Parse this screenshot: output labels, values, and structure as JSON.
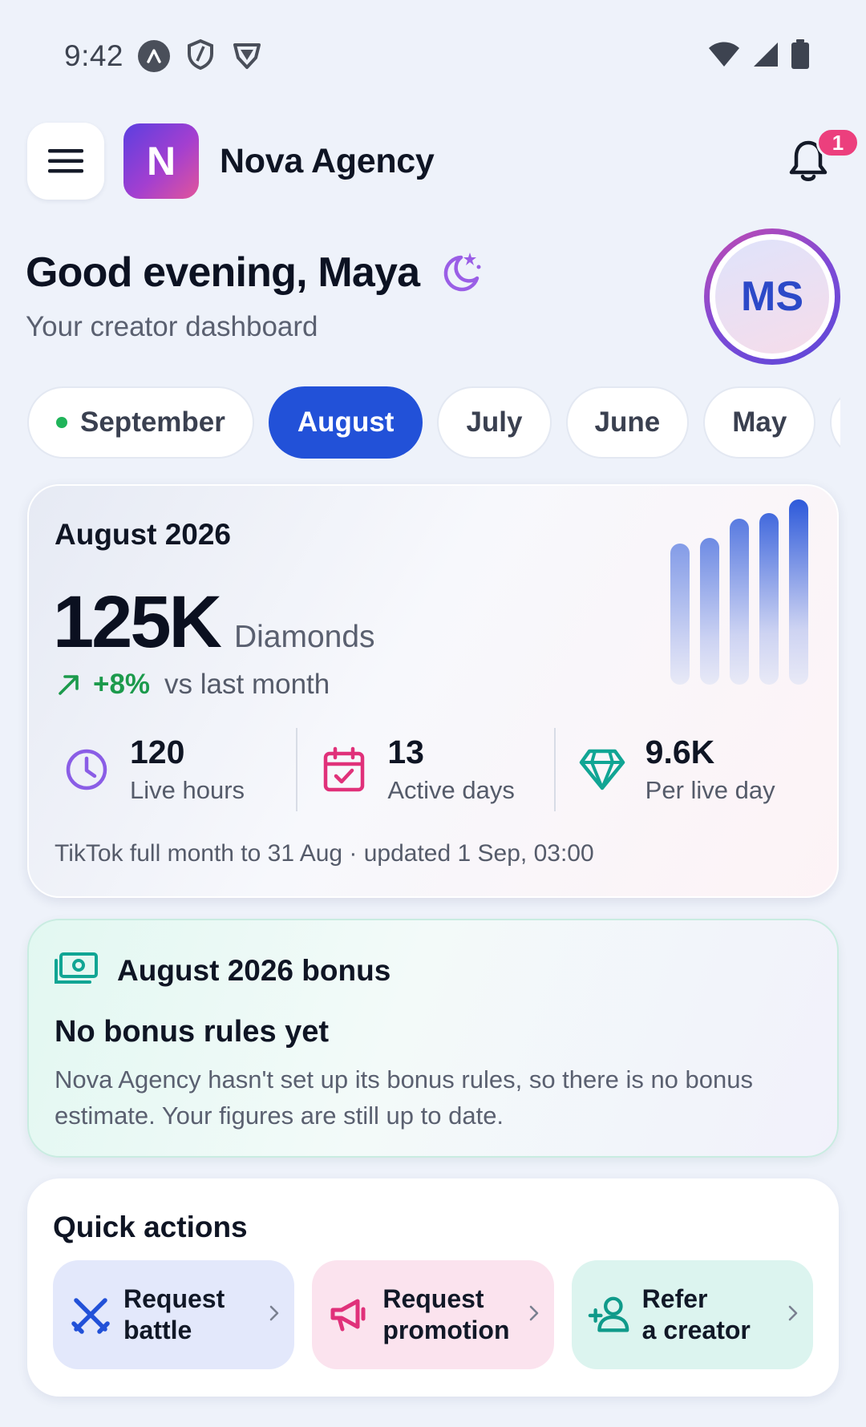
{
  "status_bar": {
    "time": "9:42",
    "left_icons": [
      "a-badge-icon",
      "shield-icon",
      "shield-v-icon"
    ],
    "right_icons": [
      "wifi-icon",
      "cell-signal-icon",
      "battery-icon"
    ]
  },
  "header": {
    "logo_letter": "N",
    "brand_name": "Nova Agency",
    "notification_count": "1"
  },
  "greeting": {
    "title": "Good evening, Maya",
    "subtitle": "Your creator dashboard",
    "avatar_initials": "MS"
  },
  "month_tabs": [
    {
      "label": "September",
      "live": true,
      "active": false
    },
    {
      "label": "August",
      "live": false,
      "active": true
    },
    {
      "label": "July",
      "live": false,
      "active": false
    },
    {
      "label": "June",
      "live": false,
      "active": false
    },
    {
      "label": "May",
      "live": false,
      "active": false
    },
    {
      "label": "",
      "live": false,
      "active": false
    }
  ],
  "earnings": {
    "title": "August 2026",
    "value": "125K",
    "unit": "Diamonds",
    "delta_pct": "+8%",
    "delta_text": "vs last month",
    "trend_levels": [
      0.74,
      0.77,
      0.87,
      0.9,
      0.97
    ],
    "stats": [
      {
        "value": "120",
        "label": "Live hours",
        "icon": "clock-icon"
      },
      {
        "value": "13",
        "label": "Active days",
        "icon": "calendar-check-icon"
      },
      {
        "value": "9.6K",
        "label": "Per live day",
        "icon": "diamond-icon"
      }
    ],
    "footnote": "TikTok full month to 31 Aug · updated 1 Sep, 03:00"
  },
  "bonus": {
    "title": "August 2026 bonus",
    "heading": "No bonus rules yet",
    "body": "Nova Agency hasn't set up its bonus rules, so there is no bonus estimate. Your figures are still up to date."
  },
  "quick_actions": {
    "title": "Quick actions",
    "items": [
      {
        "line1": "Request",
        "line2": "battle",
        "icon": "swords-icon",
        "color": "#2251d8"
      },
      {
        "line1": "Request",
        "line2": "promotion",
        "icon": "megaphone-icon",
        "color": "#e0317a"
      },
      {
        "line1": "Refer",
        "line2": "a creator",
        "icon": "user-plus-icon",
        "color": "#0f9a8a"
      }
    ]
  },
  "colors": {
    "accent": "#2251d8",
    "positive": "#1c9a4c",
    "badge": "#ec3f7d"
  }
}
